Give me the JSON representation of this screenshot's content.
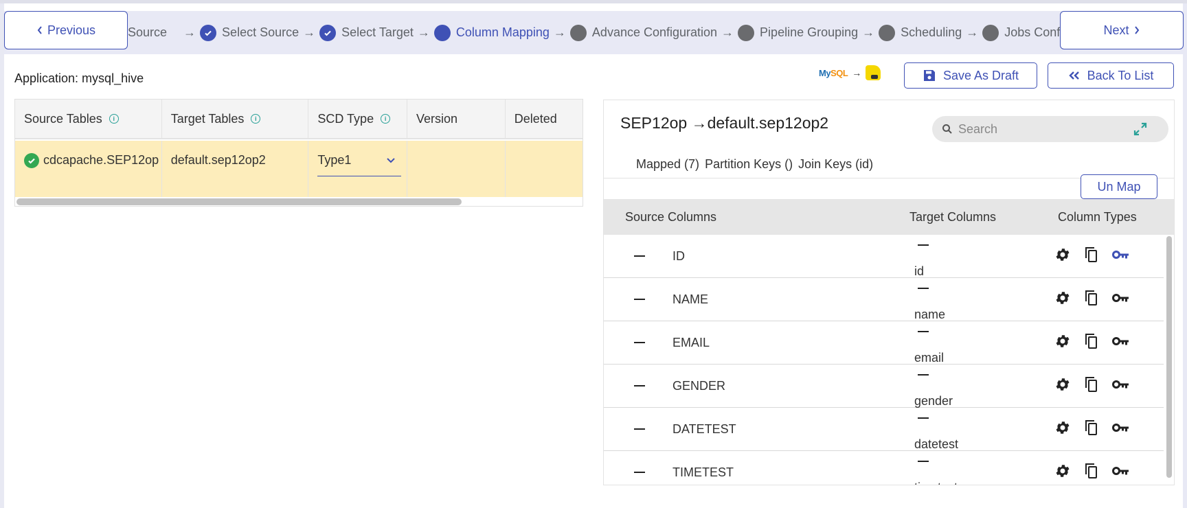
{
  "nav": {
    "previous_label": "Previous",
    "next_label": "Next"
  },
  "stepper": {
    "steps": [
      {
        "label": "Source",
        "state": "done",
        "partial": true
      },
      {
        "label": "Select Source",
        "state": "done"
      },
      {
        "label": "Select Target",
        "state": "done"
      },
      {
        "label": "Column Mapping",
        "state": "active"
      },
      {
        "label": "Advance Configuration",
        "state": "pending"
      },
      {
        "label": "Pipeline Grouping",
        "state": "pending"
      },
      {
        "label": "Scheduling",
        "state": "pending"
      },
      {
        "label": "Jobs Configura",
        "state": "pending"
      }
    ],
    "arrow": "→"
  },
  "header": {
    "application_label": "Application: mysql_hive",
    "source_logo": "MySQL",
    "target_logo": "Hive",
    "logo_arrow": "→",
    "save_draft_label": "Save As Draft",
    "back_to_list_label": "Back To List"
  },
  "tables_grid": {
    "columns": [
      "Source Tables",
      "Target Tables",
      "SCD Type",
      "Version",
      "Deleted"
    ],
    "rows": [
      {
        "source": "cdcapache.SEP12op",
        "target": "default.sep12op2",
        "scd_type": "Type1",
        "version": "",
        "deleted": "",
        "status": "valid"
      }
    ]
  },
  "mapping_panel": {
    "title": "SEP12op →default.sep12op2",
    "search_placeholder": "Search",
    "tabs": [
      "Mapped (7)",
      "Partition Keys ()",
      "Join Keys (id)"
    ],
    "unmap_label": "Un Map",
    "columns": [
      "Source Columns",
      "Target Columns",
      "Column Types"
    ],
    "rows": [
      {
        "source": "ID",
        "target": "id",
        "is_key": true
      },
      {
        "source": "NAME",
        "target": "name",
        "is_key": false
      },
      {
        "source": "EMAIL",
        "target": "email",
        "is_key": false
      },
      {
        "source": "GENDER",
        "target": "gender",
        "is_key": false
      },
      {
        "source": "DATETEST",
        "target": "datetest",
        "is_key": false
      },
      {
        "source": "TIMETEST",
        "target": "timetest",
        "is_key": false
      }
    ]
  },
  "colors": {
    "primary": "#3f51b5",
    "selected_row": "#fdedbb",
    "success": "#34a853",
    "info": "#2aa198"
  }
}
